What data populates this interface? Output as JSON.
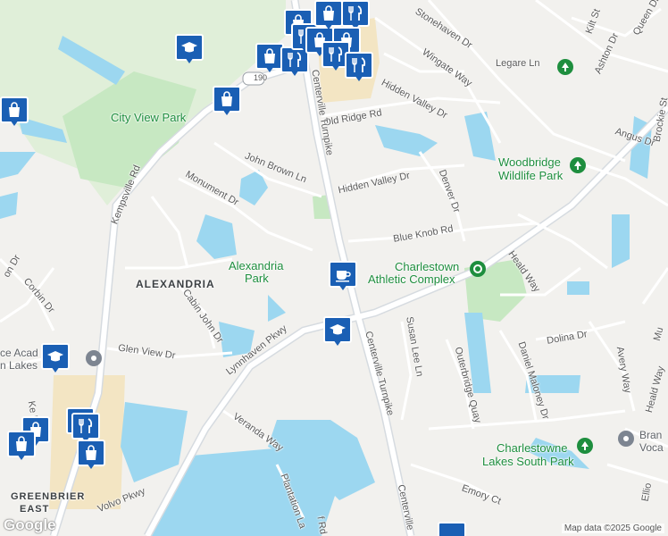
{
  "roads": {
    "stonehaven": "Stonehaven Dr",
    "wingate": "Wingate Way",
    "legare": "Legare Ln",
    "kilt": "Kilt St",
    "queen": "Queen Dr",
    "ashton": "Ashton Dr",
    "hidden_valley_dr_n": "Hidden Valley Dr",
    "hidden_valley_dr_s": "Hidden Valley Dr",
    "old_ridge": "Old Ridge Rd",
    "angus": "Angus Dr",
    "brockie": "Brockie St",
    "centerville_n": "Centerville Turnpike",
    "centerville_s": "Centerville Turnpike",
    "centerville_s2": "Centerville",
    "john_brown": "John Brown Ln",
    "monument": "Monument Dr",
    "kempsville": "Kempsville Rd",
    "denver": "Denver Dr",
    "blue_knob": "Blue Knob Rd",
    "heald_way_n": "Heald Way",
    "heald_way_s": "Heald Way",
    "corbin": "Corbin Dr",
    "cabin_john": "Cabin John Dr",
    "glen_view": "Glen View Dr",
    "lynnhaven": "Lynnhaven Pkwy",
    "susan_lee": "Susan Lee Ln",
    "outerbridge": "Outerbridge Quay",
    "daniel_maloney": "Daniel Maloney Dr",
    "dolina": "Dolina Dr",
    "avery": "Avery Way",
    "veranda": "Veranda Way",
    "plantation": "Plantation La",
    "emory": "Emory Ct",
    "volvo": "Volvo Pkwy",
    "kempsville_s": "Ke     Rd",
    "on_dr": "on Dr",
    "route_190": "190",
    "ellio": "Ellio",
    "mu": "Mu",
    "f_rd": "f Rd"
  },
  "places": {
    "city_view_park": "City View Park",
    "woodbridge_1": "Woodbridge",
    "woodbridge_2": "Wildlife Park",
    "alexandria_park_1": "Alexandria",
    "alexandria_park_2": "Park",
    "alexandria": "ALEXANDRIA",
    "charlestown_1": "Charlestown",
    "charlestown_2": "Athletic Complex",
    "charlestowne_lakes_1": "Charlestowne",
    "charlestowne_lakes_2": "Lakes South Park",
    "greenbrier_1": "GREENBRIER",
    "greenbrier_2": "EAST",
    "academy_1": "ce Acad",
    "academy_2": "n Lakes",
    "bran_1": "Bran",
    "bran_2": "Voca"
  },
  "pins": {
    "shopping": "shopping-bag-icon",
    "restaurant": "restaurant-icon",
    "school": "school-icon",
    "cafe": "cafe-icon"
  },
  "attribution": "Map data ©2025 Google",
  "google_logo": "Google",
  "colors": {
    "water": "#9cd7f0",
    "park": "#c7e8c2",
    "road": "#ffffff",
    "arterial": "#d6dbe0",
    "pin": "#1a5fb4",
    "commercial": "#f3e5c3"
  }
}
